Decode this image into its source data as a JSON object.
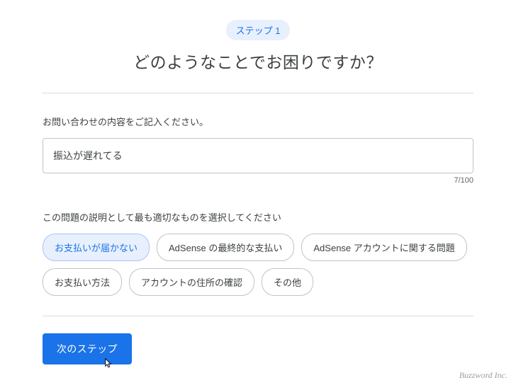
{
  "step_badge": "ステップ 1",
  "page_title": "どのようなことでお困りですか？",
  "inquiry": {
    "label": "お問い合わせの内容をご記入ください。",
    "value": "振込が遅れてる",
    "counter": "7/100"
  },
  "category": {
    "label": "この問題の説明として最も適切なものを選択してください",
    "options": [
      {
        "label": "お支払いが届かない",
        "selected": true
      },
      {
        "label": "AdSense の最終的な支払い",
        "selected": false
      },
      {
        "label": "AdSense アカウントに関する問題",
        "selected": false
      },
      {
        "label": "お支払い方法",
        "selected": false
      },
      {
        "label": "アカウントの住所の確認",
        "selected": false
      },
      {
        "label": "その他",
        "selected": false
      }
    ]
  },
  "next_button": "次のステップ",
  "footer_brand": "Buzzword Inc."
}
